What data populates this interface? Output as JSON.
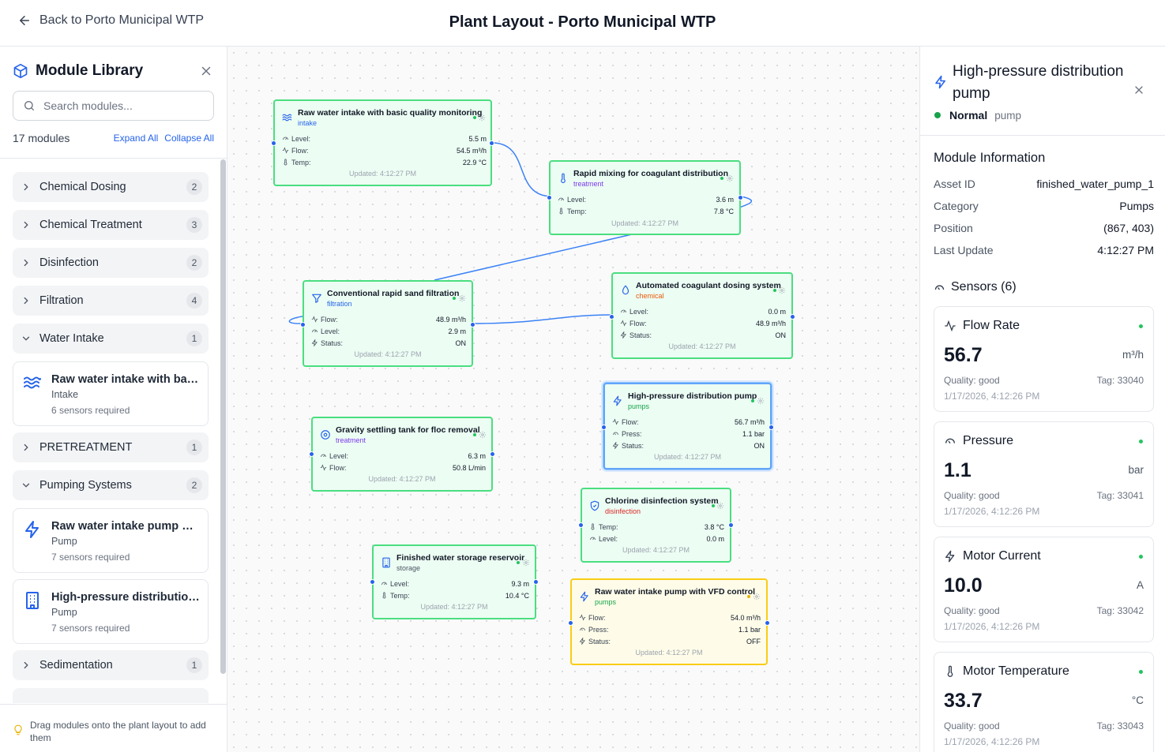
{
  "header": {
    "back_label": "Back to Porto Municipal WTP",
    "title": "Plant Layout - Porto Municipal WTP"
  },
  "sidebar": {
    "title": "Module Library",
    "search_placeholder": "Search modules...",
    "count": "17 modules",
    "expand_all": "Expand All",
    "collapse_all": "Collapse All",
    "categories": [
      {
        "label": "Chemical Dosing",
        "count": "2",
        "expanded": false
      },
      {
        "label": "Chemical Treatment",
        "count": "3",
        "expanded": false
      },
      {
        "label": "Disinfection",
        "count": "2",
        "expanded": false
      },
      {
        "label": "Filtration",
        "count": "4",
        "expanded": false
      },
      {
        "label": "Water Intake",
        "count": "1",
        "expanded": true
      },
      {
        "label": "PRETREATMENT",
        "count": "1",
        "expanded": false
      },
      {
        "label": "Pumping Systems",
        "count": "2",
        "expanded": true
      },
      {
        "label": "Sedimentation",
        "count": "1",
        "expanded": false
      }
    ],
    "modules": [
      {
        "name": "Raw water intake with basic quality monitoring",
        "type": "Intake",
        "requirement": "6 sensors required",
        "icon": "waves-icon"
      },
      {
        "name": "Raw water intake pump with VFD control",
        "type": "Pump",
        "requirement": "7 sensors required",
        "icon": "bolt-icon"
      },
      {
        "name": "High-pressure distribution pump",
        "type": "Pump",
        "requirement": "7 sensors required",
        "icon": "building-icon"
      }
    ],
    "footer_hint": "Drag modules onto the plant layout to add them"
  },
  "canvas": {
    "nodes": [
      {
        "title": "Raw water intake with basic quality monitoring",
        "category": "intake",
        "category_color": "#2563eb",
        "icon": "waves-icon",
        "rows": [
          {
            "label": "Level:",
            "value": "5.5 m",
            "icon": "gauge-icon"
          },
          {
            "label": "Flow:",
            "value": "54.5 m³/h",
            "icon": "activity-icon"
          },
          {
            "label": "Temp:",
            "value": "22.9 °C",
            "icon": "thermometer-icon"
          }
        ],
        "updated": "Updated: 4:12:27 PM"
      },
      {
        "title": "Rapid mixing for coagulant distribution",
        "category": "treatment",
        "category_color": "#7c3aed",
        "icon": "thermometer-icon",
        "rows": [
          {
            "label": "Level:",
            "value": "3.6 m",
            "icon": "gauge-icon"
          },
          {
            "label": "Temp:",
            "value": "7.8 °C",
            "icon": "thermometer-icon"
          }
        ],
        "updated": "Updated: 4:12:27 PM"
      },
      {
        "title": "Conventional rapid sand filtration",
        "category": "filtration",
        "category_color": "#2563eb",
        "icon": "funnel-icon",
        "rows": [
          {
            "label": "Flow:",
            "value": "48.9 m³/h",
            "icon": "activity-icon"
          },
          {
            "label": "Level:",
            "value": "2.9 m",
            "icon": "gauge-icon"
          },
          {
            "label": "Status:",
            "value": "ON",
            "icon": "bolt-icon"
          }
        ],
        "updated": "Updated: 4:12:27 PM"
      },
      {
        "title": "Automated coagulant dosing system",
        "category": "chemical",
        "category_color": "#ea580c",
        "icon": "droplet-icon",
        "rows": [
          {
            "label": "Level:",
            "value": "0.0 m",
            "icon": "gauge-icon"
          },
          {
            "label": "Flow:",
            "value": "48.9 m³/h",
            "icon": "activity-icon"
          },
          {
            "label": "Status:",
            "value": "ON",
            "icon": "bolt-icon"
          }
        ],
        "updated": "Updated: 4:12:27 PM"
      },
      {
        "title": "High-pressure distribution pump",
        "category": "pumps",
        "category_color": "#16a34a",
        "icon": "bolt-icon",
        "rows": [
          {
            "label": "Flow:",
            "value": "56.7 m³/h",
            "icon": "activity-icon"
          },
          {
            "label": "Press:",
            "value": "1.1 bar",
            "icon": "pressure-icon"
          },
          {
            "label": "Status:",
            "value": "ON",
            "icon": "bolt-icon"
          }
        ],
        "updated": "Updated: 4:12:27 PM"
      },
      {
        "title": "Gravity settling tank for floc removal",
        "category": "treatment",
        "category_color": "#7c3aed",
        "icon": "target-icon",
        "rows": [
          {
            "label": "Level:",
            "value": "6.3 m",
            "icon": "gauge-icon"
          },
          {
            "label": "Flow:",
            "value": "50.8 L/min",
            "icon": "activity-icon"
          }
        ],
        "updated": "Updated: 4:12:27 PM"
      },
      {
        "title": "Chlorine disinfection system",
        "category": "disinfection",
        "category_color": "#dc2626",
        "icon": "shield-icon",
        "rows": [
          {
            "label": "Temp:",
            "value": "3.8 °C",
            "icon": "thermometer-icon"
          },
          {
            "label": "Level:",
            "value": "0.0 m",
            "icon": "gauge-icon"
          }
        ],
        "updated": "Updated: 4:12:27 PM"
      },
      {
        "title": "Finished water storage reservoir",
        "category": "storage",
        "category_color": "#4b5563",
        "icon": "building-icon",
        "rows": [
          {
            "label": "Level:",
            "value": "9.3 m",
            "icon": "gauge-icon"
          },
          {
            "label": "Temp:",
            "value": "10.4 °C",
            "icon": "thermometer-icon"
          }
        ],
        "updated": "Updated: 4:12:27 PM"
      },
      {
        "title": "Raw water intake pump with VFD control",
        "category": "pumps",
        "category_color": "#16a34a",
        "icon": "bolt-icon",
        "rows": [
          {
            "label": "Flow:",
            "value": "54.0 m³/h",
            "icon": "activity-icon"
          },
          {
            "label": "Press:",
            "value": "1.1 bar",
            "icon": "pressure-icon"
          },
          {
            "label": "Status:",
            "value": "OFF",
            "icon": "bolt-icon"
          }
        ],
        "updated": "Updated: 4:12:27 PM"
      }
    ]
  },
  "details": {
    "title": "High-pressure distribution pump",
    "status": "Normal",
    "status_color": "#16a34a",
    "category": "pump",
    "info_heading": "Module Information",
    "info": [
      {
        "key": "Asset ID",
        "value": "finished_water_pump_1"
      },
      {
        "key": "Category",
        "value": "Pumps"
      },
      {
        "key": "Position",
        "value": "(867, 403)"
      },
      {
        "key": "Last Update",
        "value": "4:12:27 PM"
      }
    ],
    "sensors_heading": "Sensors (6)",
    "sensors": [
      {
        "name": "Flow Rate",
        "value": "56.7",
        "unit": "m³/h",
        "quality": "Quality: good",
        "tag": "Tag: 33040",
        "timestamp": "1/17/2026, 4:12:26 PM",
        "icon": "activity-icon"
      },
      {
        "name": "Pressure",
        "value": "1.1",
        "unit": "bar",
        "quality": "Quality: good",
        "tag": "Tag: 33041",
        "timestamp": "1/17/2026, 4:12:26 PM",
        "icon": "pressure-icon"
      },
      {
        "name": "Motor Current",
        "value": "10.0",
        "unit": "A",
        "quality": "Quality: good",
        "tag": "Tag: 33042",
        "timestamp": "1/17/2026, 4:12:26 PM",
        "icon": "bolt-icon"
      },
      {
        "name": "Motor Temperature",
        "value": "33.7",
        "unit": "°C",
        "quality": "Quality: good",
        "tag": "Tag: 33043",
        "timestamp": "1/17/2026, 4:12:26 PM",
        "icon": "thermometer-icon"
      }
    ]
  },
  "colors": {
    "accent": "#2563eb",
    "node_fill": "#ecfdf3",
    "node_border": "#4ade80",
    "node_selected_border": "#60a5fa",
    "node_warning_fill": "#fefce8",
    "node_warning_border": "#facc15"
  }
}
